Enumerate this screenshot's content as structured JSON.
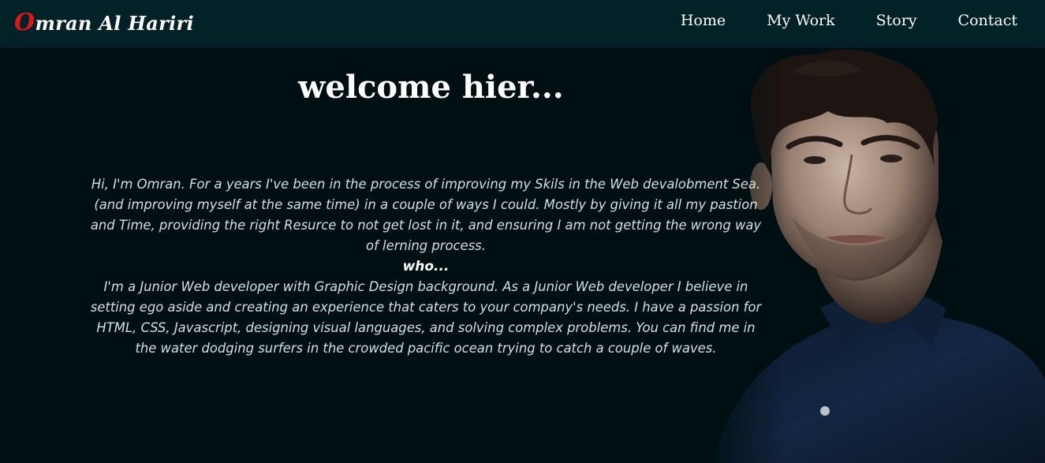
{
  "brand": {
    "initial": "O",
    "rest": "mran Al Hariri"
  },
  "nav": {
    "items": [
      {
        "label": "Home"
      },
      {
        "label": "My Work"
      },
      {
        "label": "Story"
      },
      {
        "label": "Contact"
      }
    ]
  },
  "hero": {
    "title": "welcome hier...",
    "paragraph1": "Hi, I'm Omran. For a years I've been in the process of improving my Skils in the Web devalobment Sea. (and improving myself at the same time) in a couple of ways I could. Mostly by giving it all my pastion and Time, providing the right Resurce to not get lost in it, and ensuring I am not getting the wrong way of lerning process.",
    "subheading": "who...",
    "paragraph2": "I'm a Junior Web developer with Graphic Design background. As a Junior Web developer I believe in setting ego aside and creating an experience that caters to your company's needs. I have a passion for HTML, CSS, Javascript, designing visual languages, and solving complex problems. You can find me in the water dodging surfers in the crowded pacific ocean trying to catch a couple of waves."
  },
  "colors": {
    "background": "#000f12",
    "navbar": "#032228",
    "accent": "#d81919",
    "text": "#ffffff"
  }
}
